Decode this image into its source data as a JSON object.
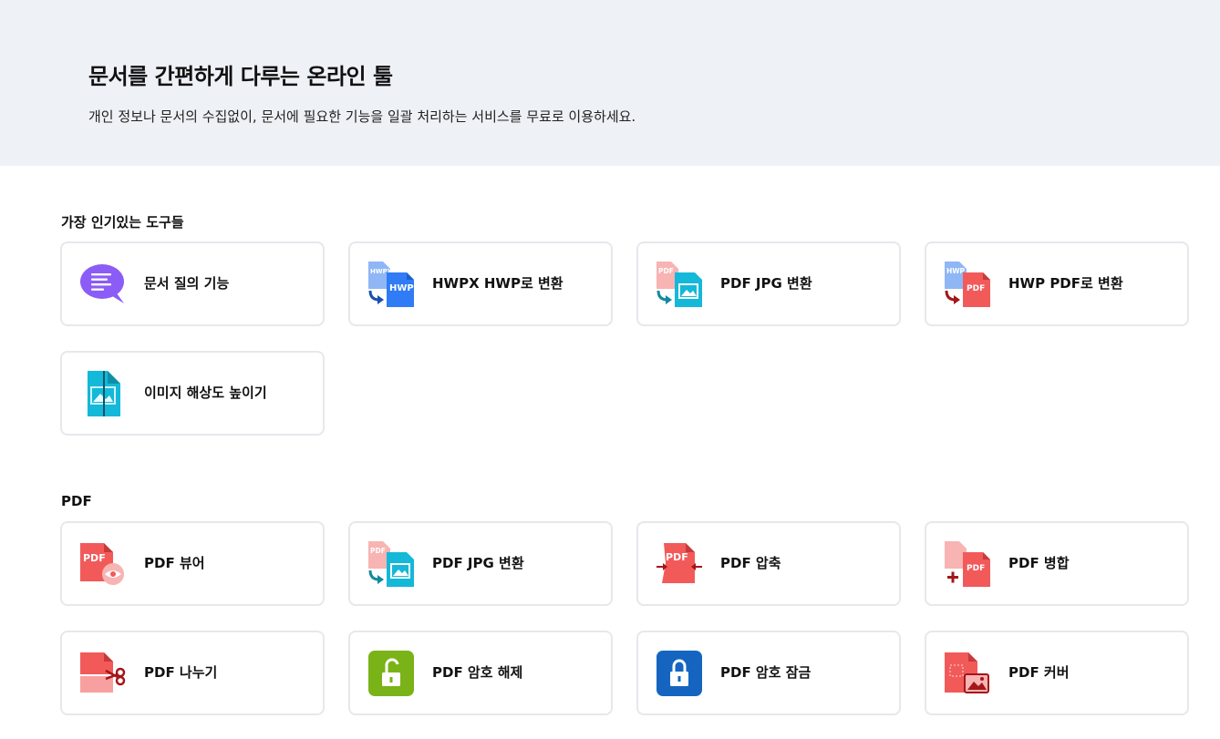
{
  "hero": {
    "title": "문서를 간편하게 다루는 온라인 툴",
    "subtitle": "개인 정보나 문서의 수집없이, 문서에 필요한 기능을 일괄 처리하는 서비스를 무료로 이용하세요."
  },
  "popular": {
    "title": "가장 인기있는 도구들",
    "items": [
      {
        "label": "문서 질의 기능",
        "icon": "chat-bubble-icon"
      },
      {
        "label": "HWPX HWP로 변환",
        "icon": "hwpx-to-hwp-icon"
      },
      {
        "label": "PDF JPG 변환",
        "icon": "pdf-to-jpg-icon"
      },
      {
        "label": "HWP PDF로 변환",
        "icon": "hwp-to-pdf-icon"
      },
      {
        "label": "이미지 해상도 높이기",
        "icon": "image-upscale-icon"
      }
    ]
  },
  "pdf": {
    "title": "PDF",
    "items": [
      {
        "label": "PDF 뷰어",
        "icon": "pdf-viewer-icon"
      },
      {
        "label": "PDF JPG 변환",
        "icon": "pdf-to-jpg-icon"
      },
      {
        "label": "PDF 압축",
        "icon": "pdf-compress-icon"
      },
      {
        "label": "PDF 병합",
        "icon": "pdf-merge-icon"
      },
      {
        "label": "PDF 나누기",
        "icon": "pdf-split-icon"
      },
      {
        "label": "PDF 암호 해제",
        "icon": "unlock-icon"
      },
      {
        "label": "PDF 암호 잠금",
        "icon": "lock-icon"
      },
      {
        "label": "PDF 커버",
        "icon": "pdf-cover-icon"
      }
    ]
  },
  "icon_text": {
    "pdf": "PDF",
    "hwp": "HWP",
    "hwpx_small": "HWPX",
    "hwp_small": "HWP"
  },
  "colors": {
    "hero_bg": "#eef1f6",
    "card_border": "#e6e8ec",
    "pdf_red": "#f25a5a",
    "pdf_pink": "#f8b3b3",
    "hwp_blue": "#2f7cf6",
    "hwp_light": "#8fb6f5",
    "jpg_cyan": "#14b8d8",
    "purple": "#8b5cf6",
    "green": "#7ab317",
    "dark_blue": "#1565c0"
  }
}
